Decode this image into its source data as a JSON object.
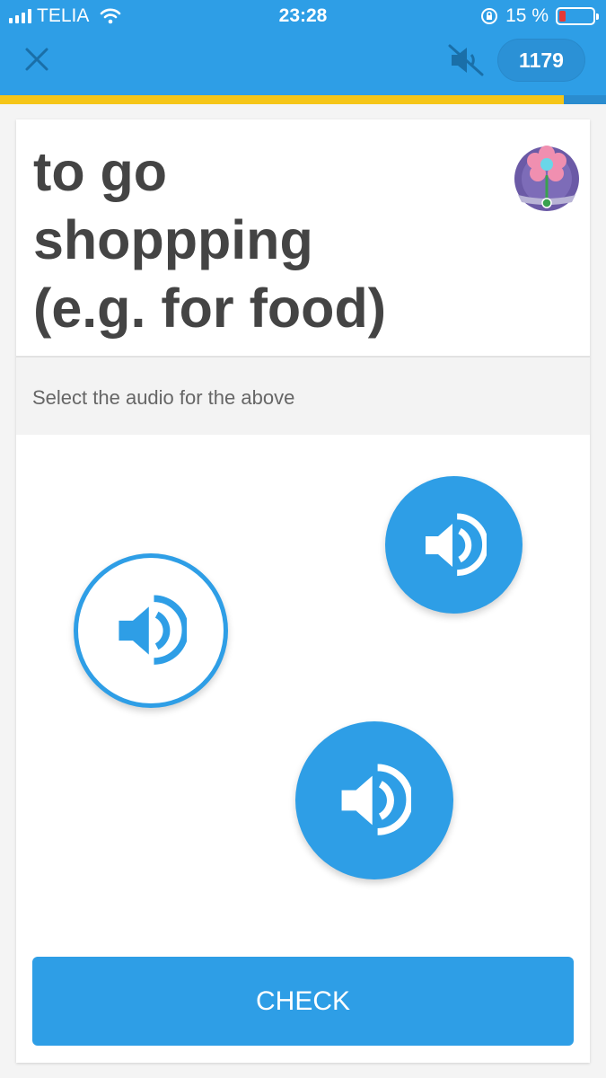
{
  "status_bar": {
    "carrier": "TELIA",
    "time": "23:28",
    "battery_percent": "15 %",
    "signal_icon": "signal-bars-icon",
    "wifi_icon": "wifi-icon",
    "lock_icon": "rotation-lock-icon",
    "battery_icon": "battery-icon"
  },
  "header": {
    "close_icon": "close-icon",
    "mute_icon": "speaker-muted-icon",
    "points": "1179",
    "progress": 0.93
  },
  "card": {
    "prompt_lines": [
      "to go",
      "shoppping",
      "(e.g. for food)"
    ],
    "avatar_icon": "flower-pot-icon",
    "instruction": "Select the audio for the above",
    "audio_options": [
      {
        "icon": "speaker-icon",
        "style": "filled"
      },
      {
        "icon": "speaker-icon",
        "style": "outlined"
      },
      {
        "icon": "speaker-icon",
        "style": "filled"
      }
    ]
  },
  "check_label": "CHECK",
  "colors": {
    "primary": "#2e9ee6",
    "progress": "#f5c518",
    "text": "#444444"
  }
}
